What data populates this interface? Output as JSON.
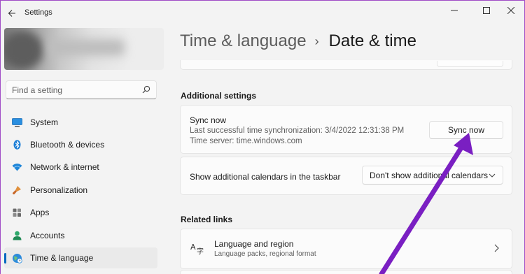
{
  "window": {
    "title": "Settings",
    "back_icon": "arrow-left-icon",
    "controls": [
      "minimize-icon",
      "maximize-icon",
      "close-icon"
    ]
  },
  "sidebar": {
    "search_placeholder": "Find a setting",
    "items": [
      {
        "label": "System",
        "icon": "monitor-icon",
        "selected": false
      },
      {
        "label": "Bluetooth & devices",
        "icon": "bluetooth-icon",
        "selected": false
      },
      {
        "label": "Network & internet",
        "icon": "wifi-icon",
        "selected": false
      },
      {
        "label": "Personalization",
        "icon": "paintbrush-icon",
        "selected": false
      },
      {
        "label": "Apps",
        "icon": "apps-grid-icon",
        "selected": false
      },
      {
        "label": "Accounts",
        "icon": "person-icon",
        "selected": false
      },
      {
        "label": "Time & language",
        "icon": "globe-clock-icon",
        "selected": true
      }
    ]
  },
  "breadcrumb": {
    "parent": "Time & language",
    "separator": "›",
    "current": "Date & time"
  },
  "additional_settings": {
    "title": "Additional settings",
    "sync": {
      "title": "Sync now",
      "last_sync": "Last successful time synchronization: 3/4/2022 12:31:38 PM",
      "time_server": "Time server: time.windows.com",
      "button": "Sync now"
    },
    "calendars": {
      "label": "Show additional calendars in the taskbar",
      "selected": "Don't show additional calendars"
    }
  },
  "related_links": {
    "title": "Related links",
    "items": [
      {
        "title": "Language and region",
        "subtitle": "Language packs, regional format",
        "icon": "language-icon"
      }
    ]
  },
  "colors": {
    "accent": "#0067c0",
    "annotation_arrow": "#7a1fc2",
    "frame": "#a04cc6"
  }
}
